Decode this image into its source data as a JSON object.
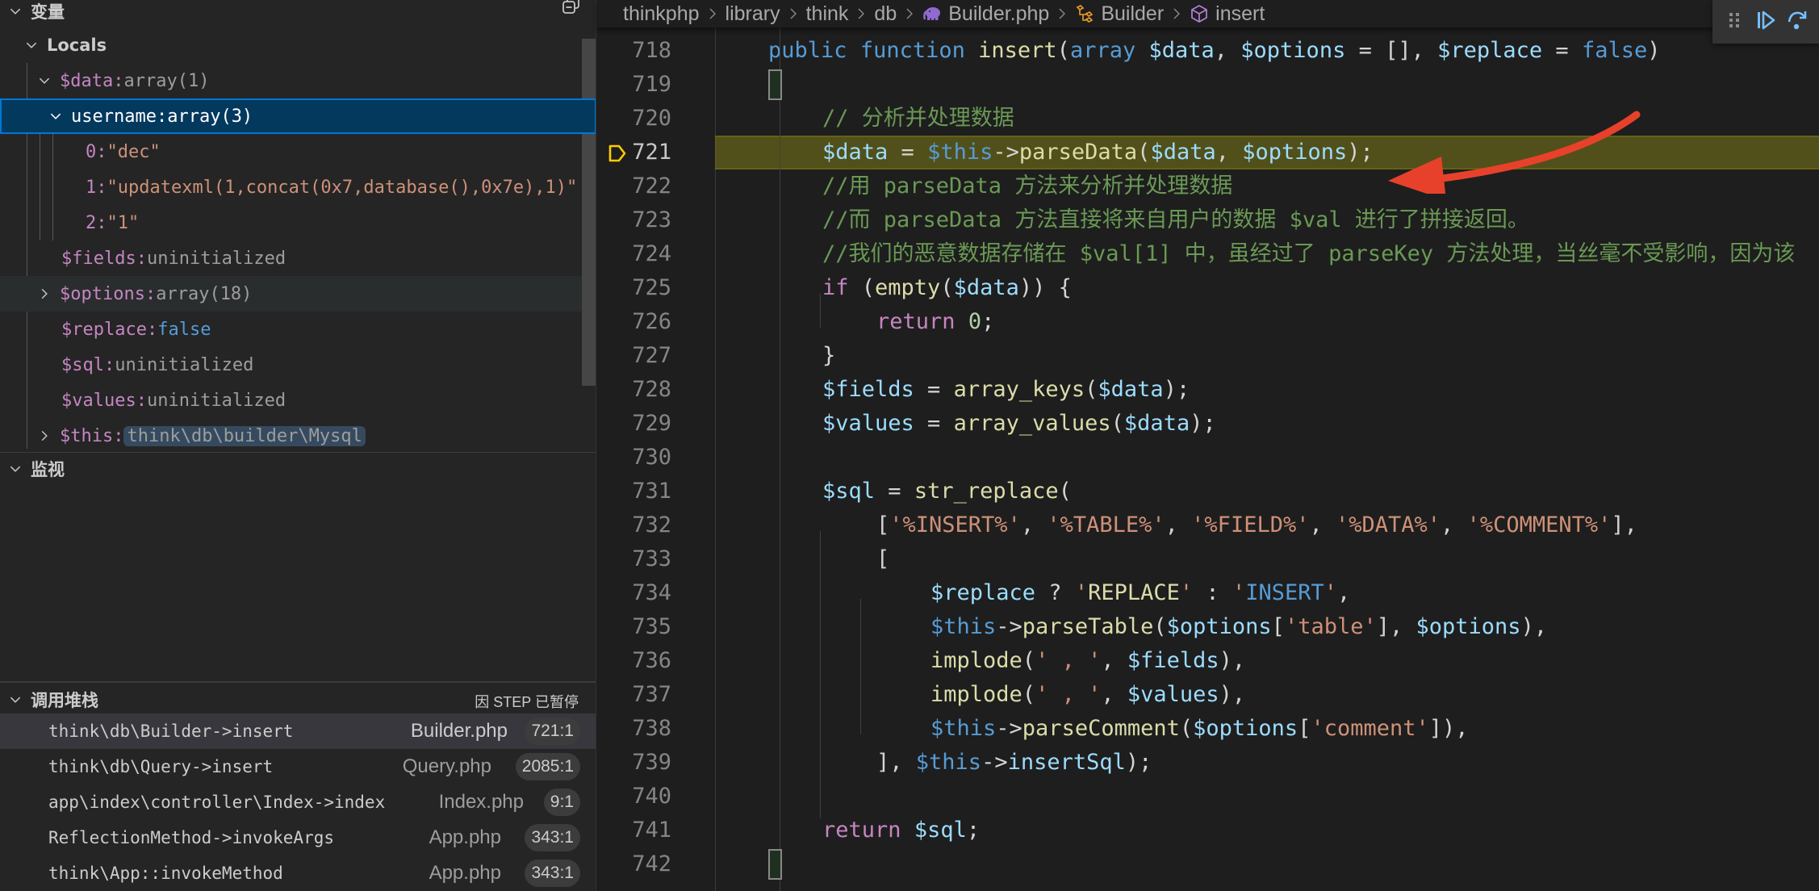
{
  "sidebar": {
    "variables_title": "变量",
    "locals_title": "Locals",
    "locals": [
      {
        "name": "$data",
        "value": "array(1)",
        "kind": "plain",
        "expanded": true
      },
      {
        "name": "username",
        "value": "array(3)",
        "kind": "plain",
        "expanded": true,
        "selected": true
      },
      {
        "name": "0",
        "value": "\"dec\"",
        "kind": "string"
      },
      {
        "name": "1",
        "value": "\"updatexml(1,concat(0x7,database(),0x7e),1)\"",
        "kind": "string"
      },
      {
        "name": "2",
        "value": "\"1\"",
        "kind": "string"
      },
      {
        "name": "$fields",
        "value": "uninitialized",
        "kind": "plain"
      },
      {
        "name": "$options",
        "value": "array(18)",
        "kind": "plain",
        "expanded": false
      },
      {
        "name": "$replace",
        "value": "false",
        "kind": "bool"
      },
      {
        "name": "$sql",
        "value": "uninitialized",
        "kind": "plain"
      },
      {
        "name": "$values",
        "value": "uninitialized",
        "kind": "plain"
      },
      {
        "name": "$this",
        "value": "think\\db\\builder\\Mysql",
        "kind": "class",
        "expanded": false
      }
    ],
    "watch_title": "监视",
    "callstack_title": "调用堆栈",
    "callstack_status": "因 STEP 已暂停",
    "callstack": [
      {
        "fn": "think\\db\\Builder->insert",
        "file": "Builder.php",
        "pos": "721:1",
        "active": true
      },
      {
        "fn": "think\\db\\Query->insert",
        "file": "Query.php",
        "pos": "2085:1"
      },
      {
        "fn": "app\\index\\controller\\Index->index",
        "file": "Index.php",
        "pos": "9:1"
      },
      {
        "fn": "ReflectionMethod->invokeArgs",
        "file": "App.php",
        "pos": "343:1"
      },
      {
        "fn": "think\\App::invokeMethod",
        "file": "App.php",
        "pos": "343:1"
      }
    ]
  },
  "breadcrumb": {
    "items": [
      "thinkphp",
      "library",
      "think",
      "db",
      "Builder.php",
      "Builder",
      "insert"
    ],
    "icons": [
      "",
      "",
      "",
      "",
      "php-elephant-icon",
      "class-icon",
      "method-icon"
    ]
  },
  "editor": {
    "current_line": 721,
    "lines": [
      {
        "n": 718,
        "indent": 1,
        "tokens": [
          [
            "kw",
            "public"
          ],
          [
            "pun",
            " "
          ],
          [
            "kw",
            "function"
          ],
          [
            "pun",
            " "
          ],
          [
            "fn",
            "insert"
          ],
          [
            "pun",
            "("
          ],
          [
            "kw",
            "array"
          ],
          [
            "pun",
            " "
          ],
          [
            "var",
            "$data"
          ],
          [
            "pun",
            ", "
          ],
          [
            "var",
            "$options"
          ],
          [
            "pun",
            " = [], "
          ],
          [
            "var",
            "$replace"
          ],
          [
            "pun",
            " = "
          ],
          [
            "const",
            "false"
          ],
          [
            "pun",
            ")"
          ]
        ]
      },
      {
        "n": 719,
        "indent": 1,
        "tokens": [
          [
            "pun",
            "{"
          ]
        ]
      },
      {
        "n": 720,
        "indent": 2,
        "tokens": [
          [
            "cmt",
            "// 分析并处理数据"
          ]
        ]
      },
      {
        "n": 721,
        "indent": 2,
        "tokens": [
          [
            "var",
            "$data"
          ],
          [
            "pun",
            " = "
          ],
          [
            "this",
            "$this"
          ],
          [
            "pun",
            "->"
          ],
          [
            "fn",
            "parseData"
          ],
          [
            "pun",
            "("
          ],
          [
            "var",
            "$data"
          ],
          [
            "pun",
            ", "
          ],
          [
            "var",
            "$options"
          ],
          [
            "pun",
            ");"
          ]
        ]
      },
      {
        "n": 722,
        "indent": 2,
        "tokens": [
          [
            "cmt",
            "//用 parseData 方法来分析并处理数据"
          ]
        ]
      },
      {
        "n": 723,
        "indent": 2,
        "tokens": [
          [
            "cmt",
            "//而 parseData 方法直接将来自用户的数据 $val 进行了拼接返回。"
          ]
        ]
      },
      {
        "n": 724,
        "indent": 2,
        "tokens": [
          [
            "cmt",
            "//我们的恶意数据存储在 $val[1] 中，虽经过了 parseKey 方法处理，当丝毫不受影响，因为该"
          ]
        ]
      },
      {
        "n": 725,
        "indent": 2,
        "tokens": [
          [
            "ctrl",
            "if"
          ],
          [
            "pun",
            " ("
          ],
          [
            "fn",
            "empty"
          ],
          [
            "pun",
            "("
          ],
          [
            "var",
            "$data"
          ],
          [
            "pun",
            ")) {"
          ]
        ]
      },
      {
        "n": 726,
        "indent": 3,
        "tokens": [
          [
            "ctrl",
            "return"
          ],
          [
            "pun",
            " "
          ],
          [
            "num",
            "0"
          ],
          [
            "pun",
            ";"
          ]
        ]
      },
      {
        "n": 727,
        "indent": 2,
        "tokens": [
          [
            "pun",
            "}"
          ]
        ]
      },
      {
        "n": 728,
        "indent": 2,
        "tokens": [
          [
            "var",
            "$fields"
          ],
          [
            "pun",
            " = "
          ],
          [
            "fn",
            "array_keys"
          ],
          [
            "pun",
            "("
          ],
          [
            "var",
            "$data"
          ],
          [
            "pun",
            ");"
          ]
        ]
      },
      {
        "n": 729,
        "indent": 2,
        "tokens": [
          [
            "var",
            "$values"
          ],
          [
            "pun",
            " = "
          ],
          [
            "fn",
            "array_values"
          ],
          [
            "pun",
            "("
          ],
          [
            "var",
            "$data"
          ],
          [
            "pun",
            ");"
          ]
        ]
      },
      {
        "n": 730,
        "indent": 2,
        "tokens": []
      },
      {
        "n": 731,
        "indent": 2,
        "tokens": [
          [
            "var",
            "$sql"
          ],
          [
            "pun",
            " = "
          ],
          [
            "fn",
            "str_replace"
          ],
          [
            "pun",
            "("
          ]
        ]
      },
      {
        "n": 732,
        "indent": 3,
        "tokens": [
          [
            "pun",
            "["
          ],
          [
            "str",
            "'%INSERT%'"
          ],
          [
            "pun",
            ", "
          ],
          [
            "str",
            "'%TABLE%'"
          ],
          [
            "pun",
            ", "
          ],
          [
            "str",
            "'%FIELD%'"
          ],
          [
            "pun",
            ", "
          ],
          [
            "str",
            "'%DATA%'"
          ],
          [
            "pun",
            ", "
          ],
          [
            "str",
            "'%COMMENT%'"
          ],
          [
            "pun",
            "],"
          ]
        ]
      },
      {
        "n": 733,
        "indent": 3,
        "tokens": [
          [
            "pun",
            "["
          ]
        ]
      },
      {
        "n": 734,
        "indent": 4,
        "tokens": [
          [
            "var",
            "$replace"
          ],
          [
            "pun",
            " ? "
          ],
          [
            "str",
            "'"
          ],
          [
            "strq",
            "REPLACE"
          ],
          [
            "str",
            "'"
          ],
          [
            "pun",
            " : "
          ],
          [
            "str",
            "'"
          ],
          [
            "strb",
            "INSERT"
          ],
          [
            "str",
            "'"
          ],
          [
            "pun",
            ","
          ]
        ]
      },
      {
        "n": 735,
        "indent": 4,
        "tokens": [
          [
            "this",
            "$this"
          ],
          [
            "pun",
            "->"
          ],
          [
            "fn",
            "parseTable"
          ],
          [
            "pun",
            "("
          ],
          [
            "var",
            "$options"
          ],
          [
            "pun",
            "["
          ],
          [
            "str",
            "'table'"
          ],
          [
            "pun",
            "], "
          ],
          [
            "var",
            "$options"
          ],
          [
            "pun",
            "),"
          ]
        ]
      },
      {
        "n": 736,
        "indent": 4,
        "tokens": [
          [
            "fn",
            "implode"
          ],
          [
            "pun",
            "("
          ],
          [
            "str",
            "' , '"
          ],
          [
            "pun",
            ", "
          ],
          [
            "var",
            "$fields"
          ],
          [
            "pun",
            "),"
          ]
        ]
      },
      {
        "n": 737,
        "indent": 4,
        "tokens": [
          [
            "fn",
            "implode"
          ],
          [
            "pun",
            "("
          ],
          [
            "str",
            "' , '"
          ],
          [
            "pun",
            ", "
          ],
          [
            "var",
            "$values"
          ],
          [
            "pun",
            "),"
          ]
        ]
      },
      {
        "n": 738,
        "indent": 4,
        "tokens": [
          [
            "this",
            "$this"
          ],
          [
            "pun",
            "->"
          ],
          [
            "fn",
            "parseComment"
          ],
          [
            "pun",
            "("
          ],
          [
            "var",
            "$options"
          ],
          [
            "pun",
            "["
          ],
          [
            "str",
            "'comment'"
          ],
          [
            "pun",
            "]),"
          ]
        ]
      },
      {
        "n": 739,
        "indent": 3,
        "tokens": [
          [
            "pun",
            "], "
          ],
          [
            "this",
            "$this"
          ],
          [
            "pun",
            "->"
          ],
          [
            "var",
            "insertSql"
          ],
          [
            "pun",
            ");"
          ]
        ]
      },
      {
        "n": 740,
        "indent": 2,
        "tokens": []
      },
      {
        "n": 741,
        "indent": 2,
        "tokens": [
          [
            "ctrl",
            "return"
          ],
          [
            "pun",
            " "
          ],
          [
            "var",
            "$sql"
          ],
          [
            "pun",
            ";"
          ]
        ]
      },
      {
        "n": 742,
        "indent": 1,
        "tokens": [
          [
            "pun",
            "}"
          ]
        ]
      }
    ]
  },
  "debug_toolbar": {
    "buttons": [
      "drag-handle",
      "continue",
      "step-over"
    ]
  },
  "colors": {
    "accent": "#0078d4",
    "current_line_highlight": "#4b4a1c",
    "annotation_arrow": "#e8412b",
    "breakpoint_indicator": "#ffcc00"
  }
}
